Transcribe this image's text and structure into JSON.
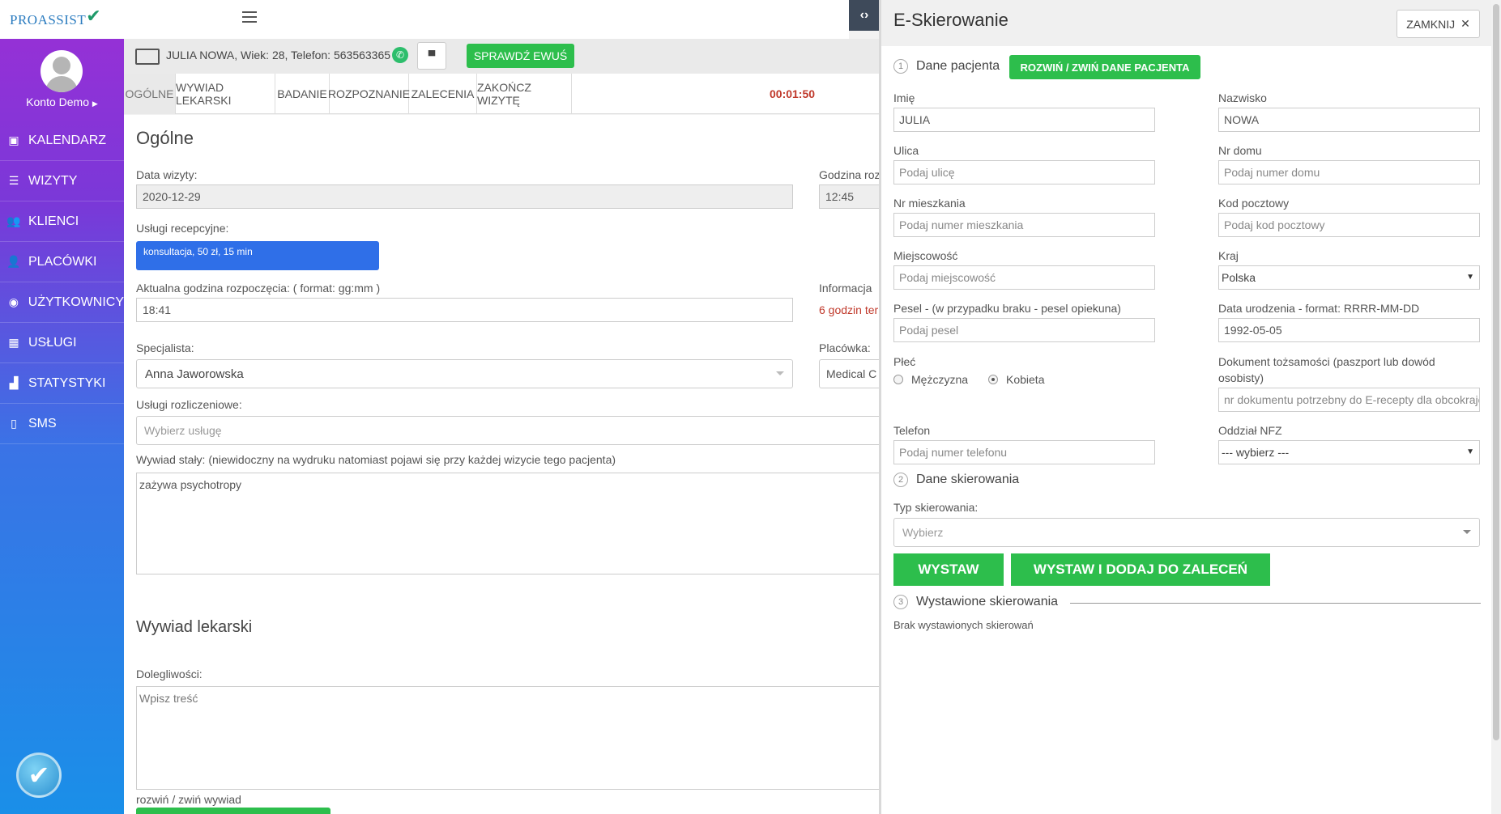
{
  "logo": {
    "text": "PROASSIST"
  },
  "account": {
    "name": "Konto Demo"
  },
  "nav": [
    {
      "label": "KALENDARZ",
      "icon": "calendar-icon"
    },
    {
      "label": "WIZYTY",
      "icon": "list-icon"
    },
    {
      "label": "KLIENCI",
      "icon": "users-icon"
    },
    {
      "label": "PLACÓWKI",
      "icon": "user-plus-icon"
    },
    {
      "label": "UŻYTKOWNICY",
      "icon": "user-circle-icon"
    },
    {
      "label": "USŁUGI",
      "icon": "grid-icon"
    },
    {
      "label": "STATYSTYKI",
      "icon": "bar-chart-icon"
    },
    {
      "label": "SMS",
      "icon": "mobile-icon"
    }
  ],
  "patientbar": {
    "info": "JULIA NOWA, Wiek: 28, Telefon: 563563365",
    "ewus_label": "SPRAWDŹ EWUŚ"
  },
  "tabs": [
    "OGÓLNE",
    "WYWIAD LEKARSKI",
    "BADANIE",
    "ROZPOZNANIE",
    "ZALECENIA",
    "ZAKOŃCZ WIZYTĘ"
  ],
  "timer": "00:01:50",
  "main": {
    "section_title": "Ogólne",
    "visit_date_label": "Data wizyty:",
    "visit_date_value": "2020-12-29",
    "start_time_label": "Godzina roz",
    "start_time_value": "12:45",
    "reception_services_label": "Usługi recepcyjne:",
    "reception_service_pill": "konsultacja, 50 zł, 15 min",
    "actual_start_label": "Aktualna godzina rozpoczęcia: ( format: gg:mm )",
    "actual_start_value": "18:41",
    "info_label": "Informacja",
    "info_value": "6 godzin ter",
    "specialist_label": "Specjalista:",
    "specialist_value": "Anna Jaworowska",
    "facility_label": "Placówka:",
    "facility_value": "Medical C",
    "billing_services_label": "Usługi rozliczeniowe:",
    "billing_services_placeholder": "Wybierz usługę",
    "permanent_history_label": "Wywiad stały: (niewidoczny na wydruku natomiast pojawi się przy każdej wizycie tego pacjenta)",
    "permanent_history_value": "zażywa psychotropy",
    "medical_history_title": "Wywiad lekarski",
    "complaints_label": "Dolegliwości:",
    "complaints_placeholder": "Wpisz treść",
    "toggle_history_label": "rozwiń / zwiń wywiad"
  },
  "panel": {
    "title": "E-Skierowanie",
    "close_label": "ZAMKNIJ",
    "step1_num": "1",
    "step1_label": "Dane pacjenta",
    "toggle_patient_label": "ROZWIŃ / ZWIŃ DANE PACJENTA",
    "first_name_label": "Imię",
    "first_name_value": "JULIA",
    "last_name_label": "Nazwisko",
    "last_name_value": "NOWA",
    "street_label": "Ulica",
    "street_placeholder": "Podaj ulicę",
    "house_no_label": "Nr domu",
    "house_no_placeholder": "Podaj numer domu",
    "apartment_label": "Nr mieszkania",
    "apartment_placeholder": "Podaj numer mieszkania",
    "postal_label": "Kod pocztowy",
    "postal_placeholder": "Podaj kod pocztowy",
    "city_label": "Miejscowość",
    "city_placeholder": "Podaj miejscowość",
    "country_label": "Kraj",
    "country_value": "Polska",
    "pesel_label": "Pesel - (w przypadku braku - pesel opiekuna)",
    "pesel_placeholder": "Podaj pesel",
    "birth_label": "Data urodzenia - format: RRRR-MM-DD",
    "birth_value": "1992-05-05",
    "sex_label": "Płeć",
    "sex_male": "Mężczyzna",
    "sex_female": "Kobieta",
    "sex_selected": "Kobieta",
    "id_doc_label": "Dokument tożsamości (paszport lub dowód osobisty)",
    "id_doc_placeholder": "nr dokumentu potrzebny do E-recepty dla obcokrajowca",
    "phone_label": "Telefon",
    "phone_placeholder": "Podaj numer telefonu",
    "nfz_label": "Oddział NFZ",
    "nfz_value": "--- wybierz ---",
    "step2_num": "2",
    "step2_label": "Dane skierowania",
    "referral_type_label": "Typ skierowania:",
    "referral_type_placeholder": "Wybierz",
    "issue_label": "WYSTAW",
    "issue_add_label": "WYSTAW I DODAJ DO ZALECEŃ",
    "step3_num": "3",
    "step3_label": "Wystawione skierowania",
    "no_referrals": "Brak wystawionych skierowań"
  },
  "colors": {
    "accent_green": "#2dbe4c",
    "timer_red": "#c0392b",
    "service_blue": "#2f6fe8"
  }
}
